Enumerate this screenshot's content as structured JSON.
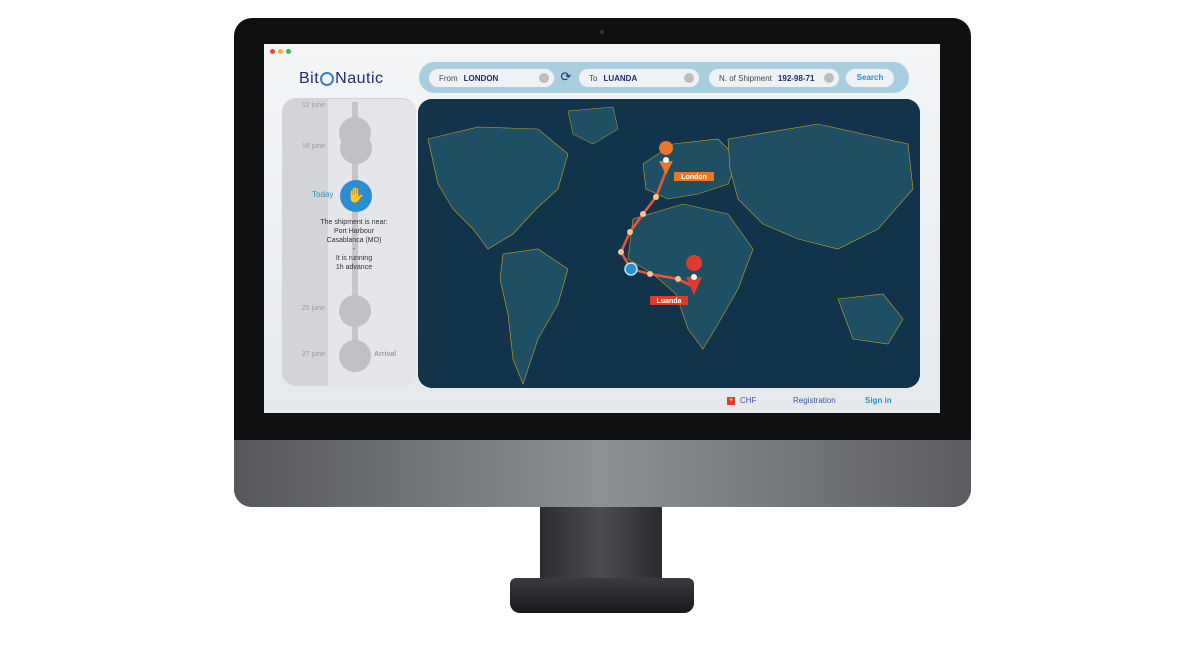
{
  "app": {
    "logo_text_left": "Bit",
    "logo_text_right": "Nautic"
  },
  "search": {
    "from_label": "From",
    "from_value": "LONDON",
    "to_label": "To",
    "to_value": "LUANDA",
    "shipment_label": "N. of Shipment",
    "shipment_value": "192-98-71",
    "button_label": "Search"
  },
  "timeline": {
    "dates": [
      "12 june",
      "18 june",
      "25 june",
      "27 june"
    ],
    "today_label": "Today",
    "status_lines": [
      "The shipment is near:",
      "Port Harbour",
      "Casablanca (MO)",
      "-",
      "It is running",
      "1h advance"
    ],
    "arrival_label": "Arrival"
  },
  "map": {
    "origin_label": "London",
    "destination_label": "Luanda",
    "colors": {
      "ocean": "#12344a",
      "land": "#1f4f63",
      "border": "#c9a227",
      "route": "#e8553a",
      "origin": "#e8762b",
      "destination": "#e03a2a"
    }
  },
  "footer": {
    "currency": "CHF",
    "registration": "Registration",
    "sign_in": "Sign in"
  }
}
